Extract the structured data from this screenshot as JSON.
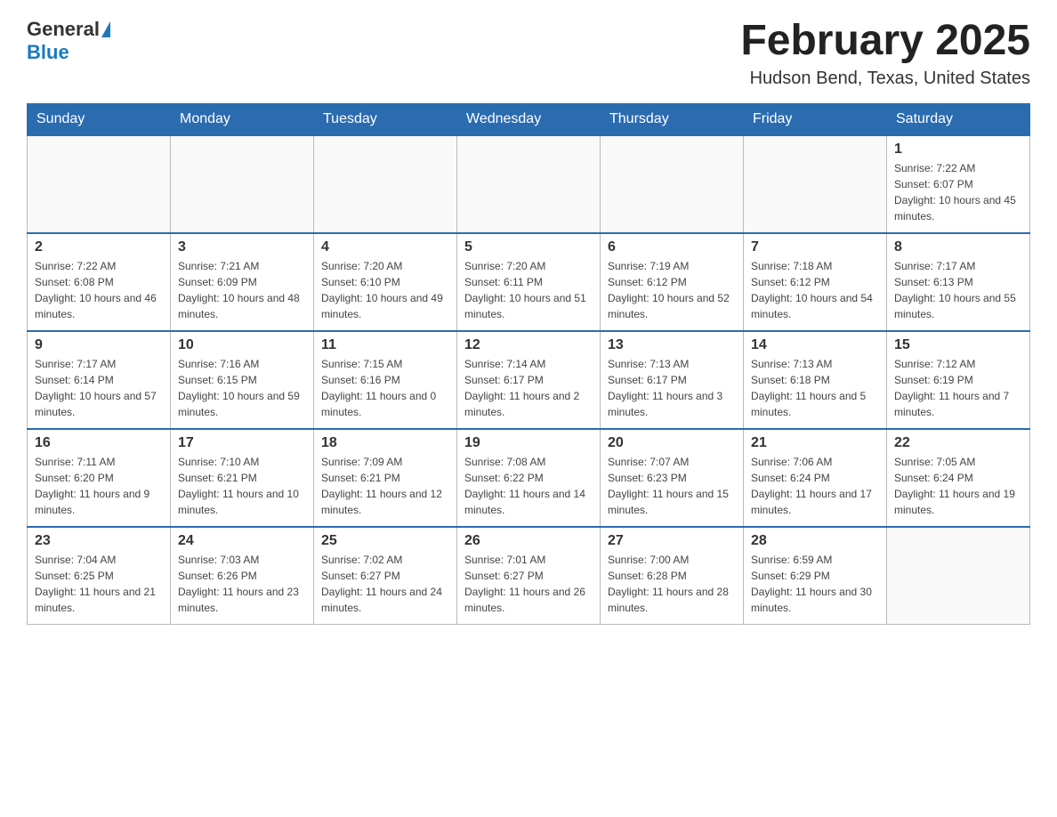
{
  "header": {
    "logo_general": "General",
    "logo_blue": "Blue",
    "month_title": "February 2025",
    "location": "Hudson Bend, Texas, United States"
  },
  "days_of_week": [
    "Sunday",
    "Monday",
    "Tuesday",
    "Wednesday",
    "Thursday",
    "Friday",
    "Saturday"
  ],
  "weeks": [
    [
      {
        "day": "",
        "info": ""
      },
      {
        "day": "",
        "info": ""
      },
      {
        "day": "",
        "info": ""
      },
      {
        "day": "",
        "info": ""
      },
      {
        "day": "",
        "info": ""
      },
      {
        "day": "",
        "info": ""
      },
      {
        "day": "1",
        "info": "Sunrise: 7:22 AM\nSunset: 6:07 PM\nDaylight: 10 hours and 45 minutes."
      }
    ],
    [
      {
        "day": "2",
        "info": "Sunrise: 7:22 AM\nSunset: 6:08 PM\nDaylight: 10 hours and 46 minutes."
      },
      {
        "day": "3",
        "info": "Sunrise: 7:21 AM\nSunset: 6:09 PM\nDaylight: 10 hours and 48 minutes."
      },
      {
        "day": "4",
        "info": "Sunrise: 7:20 AM\nSunset: 6:10 PM\nDaylight: 10 hours and 49 minutes."
      },
      {
        "day": "5",
        "info": "Sunrise: 7:20 AM\nSunset: 6:11 PM\nDaylight: 10 hours and 51 minutes."
      },
      {
        "day": "6",
        "info": "Sunrise: 7:19 AM\nSunset: 6:12 PM\nDaylight: 10 hours and 52 minutes."
      },
      {
        "day": "7",
        "info": "Sunrise: 7:18 AM\nSunset: 6:12 PM\nDaylight: 10 hours and 54 minutes."
      },
      {
        "day": "8",
        "info": "Sunrise: 7:17 AM\nSunset: 6:13 PM\nDaylight: 10 hours and 55 minutes."
      }
    ],
    [
      {
        "day": "9",
        "info": "Sunrise: 7:17 AM\nSunset: 6:14 PM\nDaylight: 10 hours and 57 minutes."
      },
      {
        "day": "10",
        "info": "Sunrise: 7:16 AM\nSunset: 6:15 PM\nDaylight: 10 hours and 59 minutes."
      },
      {
        "day": "11",
        "info": "Sunrise: 7:15 AM\nSunset: 6:16 PM\nDaylight: 11 hours and 0 minutes."
      },
      {
        "day": "12",
        "info": "Sunrise: 7:14 AM\nSunset: 6:17 PM\nDaylight: 11 hours and 2 minutes."
      },
      {
        "day": "13",
        "info": "Sunrise: 7:13 AM\nSunset: 6:17 PM\nDaylight: 11 hours and 3 minutes."
      },
      {
        "day": "14",
        "info": "Sunrise: 7:13 AM\nSunset: 6:18 PM\nDaylight: 11 hours and 5 minutes."
      },
      {
        "day": "15",
        "info": "Sunrise: 7:12 AM\nSunset: 6:19 PM\nDaylight: 11 hours and 7 minutes."
      }
    ],
    [
      {
        "day": "16",
        "info": "Sunrise: 7:11 AM\nSunset: 6:20 PM\nDaylight: 11 hours and 9 minutes."
      },
      {
        "day": "17",
        "info": "Sunrise: 7:10 AM\nSunset: 6:21 PM\nDaylight: 11 hours and 10 minutes."
      },
      {
        "day": "18",
        "info": "Sunrise: 7:09 AM\nSunset: 6:21 PM\nDaylight: 11 hours and 12 minutes."
      },
      {
        "day": "19",
        "info": "Sunrise: 7:08 AM\nSunset: 6:22 PM\nDaylight: 11 hours and 14 minutes."
      },
      {
        "day": "20",
        "info": "Sunrise: 7:07 AM\nSunset: 6:23 PM\nDaylight: 11 hours and 15 minutes."
      },
      {
        "day": "21",
        "info": "Sunrise: 7:06 AM\nSunset: 6:24 PM\nDaylight: 11 hours and 17 minutes."
      },
      {
        "day": "22",
        "info": "Sunrise: 7:05 AM\nSunset: 6:24 PM\nDaylight: 11 hours and 19 minutes."
      }
    ],
    [
      {
        "day": "23",
        "info": "Sunrise: 7:04 AM\nSunset: 6:25 PM\nDaylight: 11 hours and 21 minutes."
      },
      {
        "day": "24",
        "info": "Sunrise: 7:03 AM\nSunset: 6:26 PM\nDaylight: 11 hours and 23 minutes."
      },
      {
        "day": "25",
        "info": "Sunrise: 7:02 AM\nSunset: 6:27 PM\nDaylight: 11 hours and 24 minutes."
      },
      {
        "day": "26",
        "info": "Sunrise: 7:01 AM\nSunset: 6:27 PM\nDaylight: 11 hours and 26 minutes."
      },
      {
        "day": "27",
        "info": "Sunrise: 7:00 AM\nSunset: 6:28 PM\nDaylight: 11 hours and 28 minutes."
      },
      {
        "day": "28",
        "info": "Sunrise: 6:59 AM\nSunset: 6:29 PM\nDaylight: 11 hours and 30 minutes."
      },
      {
        "day": "",
        "info": ""
      }
    ]
  ]
}
